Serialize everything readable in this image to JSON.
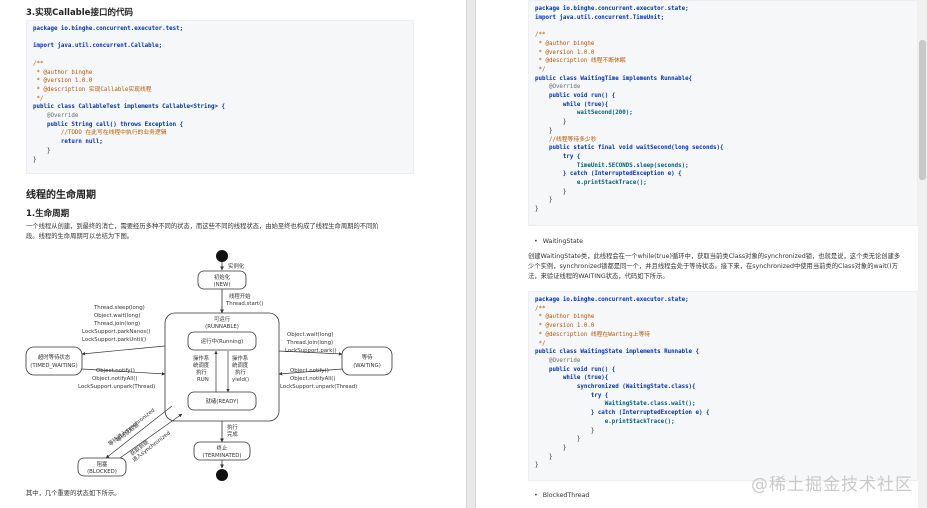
{
  "left": {
    "section_callable": "3.实现Callable接口的代码",
    "code_callable": [
      "package io.binghe.concurrent.executor.test;",
      "",
      "import java.util.concurrent.Callable;",
      "",
      "/**",
      " * @author binghe",
      " * @version 1.0.0",
      " * @description 实现Callable实现线程",
      " */",
      "public class CallableTest implements Callable<String> {",
      "    @Override",
      "    public String call() throws Exception {",
      "        //TODO 在此写在线程中执行的业务逻辑",
      "        return null;",
      "    }",
      "}"
    ],
    "heading_lifecycle": "线程的生命周期",
    "heading_lifecycle_sub": "1.生命周期",
    "para_lifecycle": [
      "一个线程从创建，到最终的消亡，需要经历多种不同的状态，而这些不同的线程状态，由始至终也构成了线程生命周期的不同阶",
      "段。线程的生命周期可以总结为下图。"
    ],
    "footer_text": "其中，几个重要的状态如下所示。"
  },
  "diagram": {
    "instantiate": "实例化",
    "new_state": [
      "初始化",
      "(NEW)"
    ],
    "start_label": [
      "线程开始",
      "Thread.start()"
    ],
    "runnable_title": [
      "可运行",
      "(RUNNABLE)"
    ],
    "running": "运行中(Running)",
    "ready": "就绪(READY)",
    "sched_left": [
      "操作系",
      "统调度",
      "执行",
      "RUN"
    ],
    "sched_right": [
      "操作系",
      "统调度",
      "执行",
      "yield()"
    ],
    "timed_waiting": [
      "超时等待状态",
      "(TIMED_WAITING)"
    ],
    "waiting": [
      "等待",
      "(WAITING)"
    ],
    "tw_in": [
      "Thread.sleep(long)",
      "Object.wait(long)",
      "Thread.join(long)",
      "LockSupport.parkNanos()",
      "LockSupport.parkUntil()"
    ],
    "tw_out": [
      "Object.notify()",
      "Object.notifyAll()",
      "LockSupport.unpark(Thread)"
    ],
    "w_in": [
      "Object.wait(long)",
      "Thread.join(long)",
      "LockSupport.park()"
    ],
    "w_out": [
      "Object.notify()",
      "Object.notifyAll()",
      "LockSupport.unpark(Thread)"
    ],
    "blocked": [
      "阻塞",
      "(BLOCKED)"
    ],
    "blocked_in": [
      "等待进入synchronized",
      "等待获取锁"
    ],
    "blocked_out": [
      "获取到锁",
      "进入synchronized"
    ],
    "finish_label": [
      "执行",
      "完成"
    ],
    "terminated": [
      "终止",
      "(TERMINATED)"
    ]
  },
  "right": {
    "code_waiting_time": [
      "package io.binghe.concurrent.executor.state;",
      "import java.util.concurrent.TimeUnit;",
      "",
      "/**",
      " * @author binghe",
      " * @version 1.0.0",
      " * @description 线程不断休眠",
      " */",
      "public class WaitingTime implements Runnable{",
      "    @Override",
      "    public void run() {",
      "        while (true){",
      "            waitSecond(200);",
      "        }",
      "    }",
      "    //线程等待多少秒",
      "    public static final void waitSecond(long seconds){",
      "        try {",
      "            TimeUnit.SECONDS.sleep(seconds);",
      "        } catch (InterruptedException e) {",
      "            e.printStackTrace();",
      "        }",
      "    }",
      "}"
    ],
    "bullet_waiting": "WaitingState",
    "para_waiting": [
      "创建WaitingState类，此线程会在一个while(true)循环中，获取当前类Class对象的synchronized锁，也就是说，这个类无论创建多",
      "少个实例，synchronized锁都是同一个，并且线程会处于等待状态。接下来，在synchronized中使用当前类的Class对象的wait()方",
      "法，来验证线程的WAITING状态，代码如下所示。"
    ],
    "code_waiting_state": [
      "package io.binghe.concurrent.executor.state;",
      "/**",
      " * @author binghe",
      " * @version 1.0.0",
      " * @description 线程在Warting上等待",
      " */",
      "public class WaitingState implements Runnable {",
      "    @Override",
      "    public void run() {",
      "        while (true){",
      "            synchronized (WaitingState.class){",
      "                try {",
      "                    WaitingState.class.wait();",
      "                } catch (InterruptedException e) {",
      "                    e.printStackTrace();",
      "                }",
      "            }",
      "        }",
      "    }",
      "}"
    ],
    "bullet_blocked": "BlockedThread"
  },
  "watermark": "@稀土掘金技术社区"
}
